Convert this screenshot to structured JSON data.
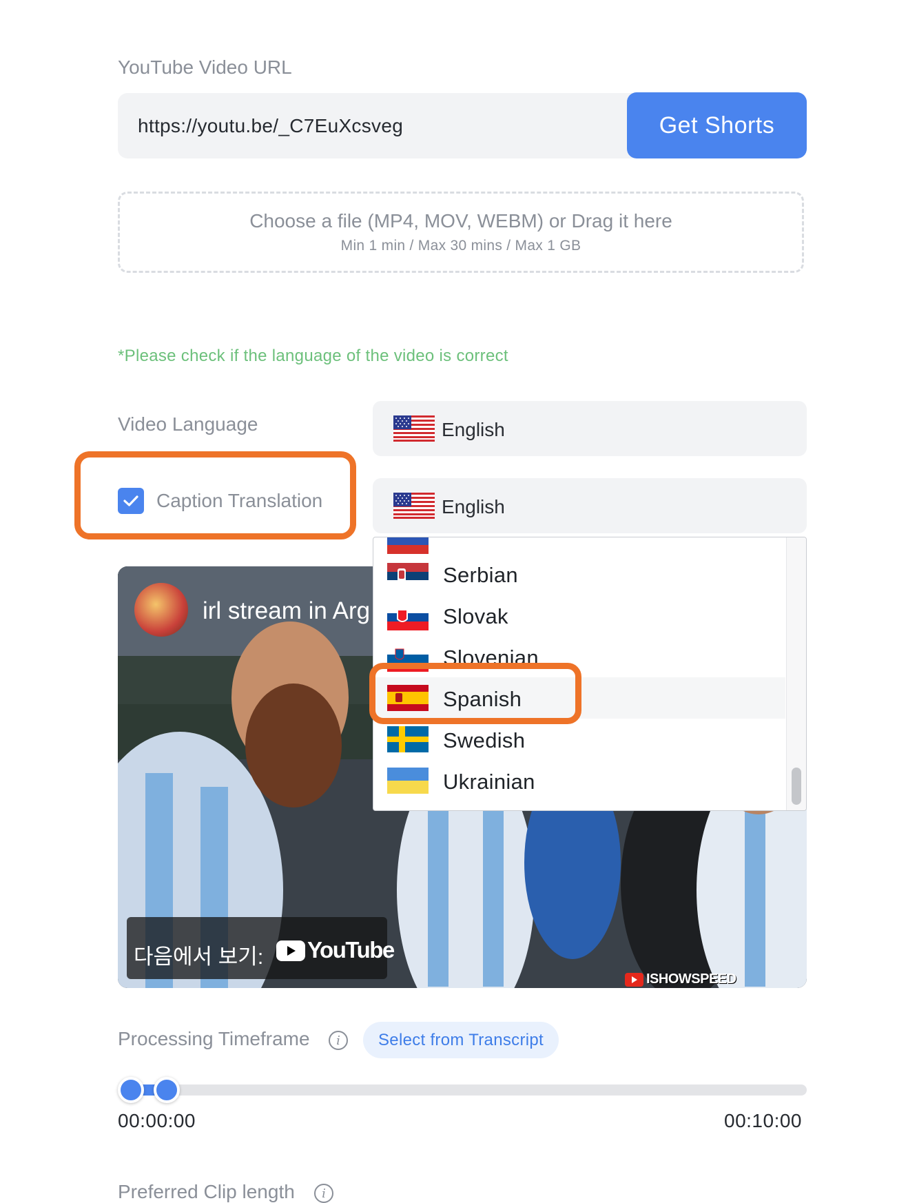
{
  "url_section": {
    "label": "YouTube Video URL",
    "url_value": "https://youtu.be/_C7EuXcsveg",
    "get_shorts_label": "Get Shorts"
  },
  "dropzone": {
    "main_text": "Choose a file (MP4, MOV, WEBM) or Drag it here",
    "sub_text": "Min 1 min / Max 30 mins / Max 1 GB"
  },
  "language_note": "*Please check if the language of the video is correct",
  "video_language": {
    "label": "Video Language",
    "selected": "English",
    "flag_icon": "us-flag-icon"
  },
  "caption_translation": {
    "label": "Caption Translation",
    "checked": true,
    "selected": "English",
    "flag_icon": "us-flag-icon"
  },
  "language_dropdown": {
    "items": [
      {
        "label": "Serbian",
        "flag_icon": "serbia-flag-icon"
      },
      {
        "label": "Slovak",
        "flag_icon": "slovakia-flag-icon"
      },
      {
        "label": "Slovenian",
        "flag_icon": "slovenia-flag-icon"
      },
      {
        "label": "Spanish",
        "flag_icon": "spain-flag-icon",
        "highlighted": true
      },
      {
        "label": "Swedish",
        "flag_icon": "sweden-flag-icon"
      },
      {
        "label": "Ukrainian",
        "flag_icon": "ukraine-flag-icon"
      }
    ]
  },
  "video": {
    "title": "irl stream in Arg",
    "watch_on": "다음에서 보기:",
    "youtube_word": "YouTube",
    "channel_badge": "ISHOWSPEED"
  },
  "processing_timeframe": {
    "label": "Processing Timeframe",
    "select_transcript_label": "Select from Transcript",
    "start_time": "00:00:00",
    "end_time": "00:10:00"
  },
  "preferred_clip_length": {
    "label": "Preferred Clip length"
  },
  "colors": {
    "accent": "#4a84ee",
    "highlight": "#ee7328",
    "note_green": "#6cc07b"
  }
}
